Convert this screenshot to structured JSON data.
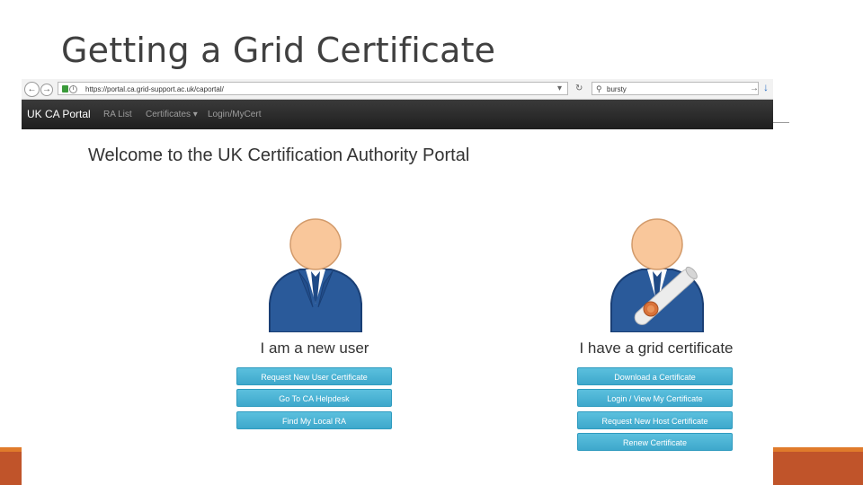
{
  "slide": {
    "title": "Getting a Grid Certificate"
  },
  "browser": {
    "url": "https://portal.ca.grid-support.ac.uk/caportal/",
    "search_text": "bursty"
  },
  "navbar": {
    "brand": "UK CA Portal",
    "links": [
      "RA List",
      "Certificates ▾",
      "Login/MyCert"
    ]
  },
  "page": {
    "welcome": "Welcome to the UK Certification Authority Portal",
    "new_user": {
      "heading": "I am a new user",
      "buttons": [
        "Request New User Certificate",
        "Go To CA Helpdesk",
        "Find My Local RA"
      ]
    },
    "have_cert": {
      "heading": "I have a grid certificate",
      "buttons": [
        "Download a Certificate",
        "Login / View My Certificate",
        "Request New Host Certificate",
        "Renew Certificate"
      ]
    }
  },
  "colors": {
    "footer": "#c0542a",
    "button": "#5bc0de",
    "suit": "#2a5a9a",
    "skin": "#f9c79b"
  }
}
